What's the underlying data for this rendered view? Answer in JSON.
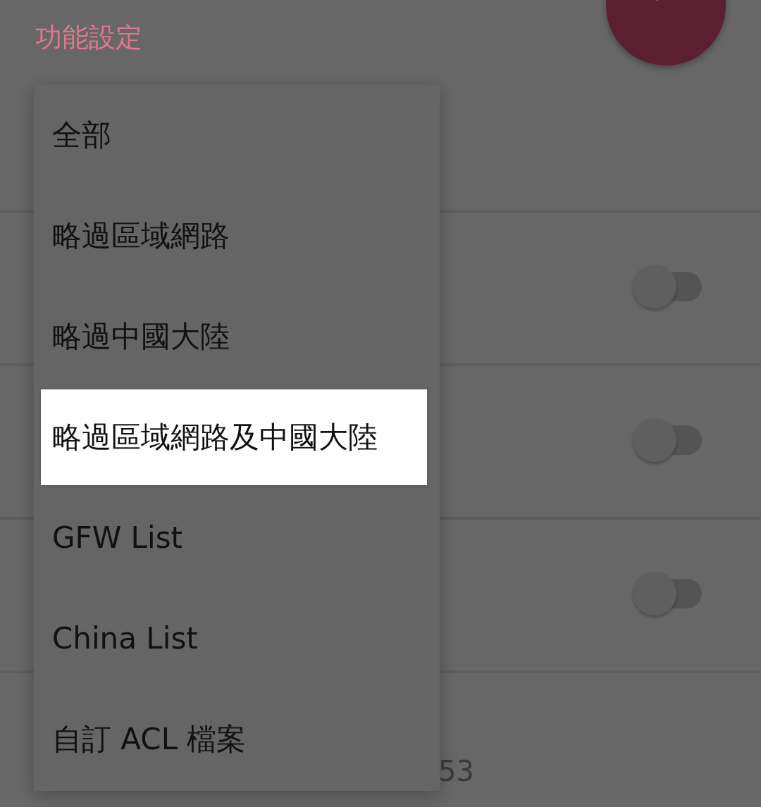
{
  "section_title": "功能設定",
  "fab": {
    "kind": "action"
  },
  "settings_rows": [
    {
      "switch_on": false
    },
    {
      "switch_on": false
    },
    {
      "switch_on": false
    }
  ],
  "bottom_value": "53",
  "menu": {
    "items": [
      {
        "label": "全部",
        "selected": false
      },
      {
        "label": "略過區域網路",
        "selected": false
      },
      {
        "label": "略過中國大陸",
        "selected": false
      },
      {
        "label": "略過區域網路及中國大陸",
        "selected": true
      },
      {
        "label": "GFW List",
        "selected": false
      },
      {
        "label": "China List",
        "selected": false
      },
      {
        "label": "自訂 ACL 檔案",
        "selected": false
      }
    ]
  }
}
